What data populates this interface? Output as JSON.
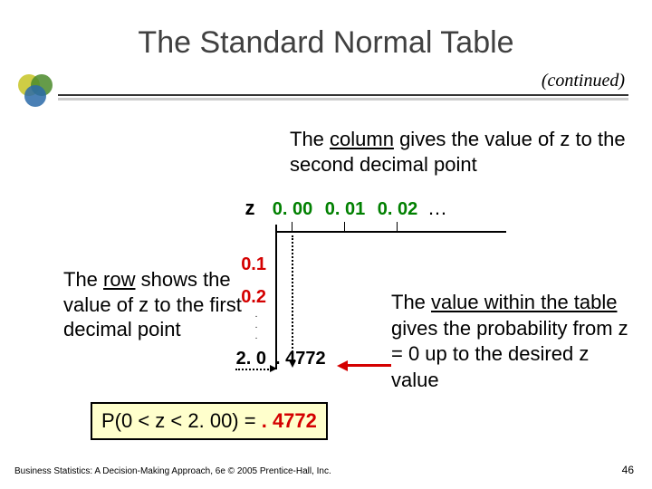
{
  "title": "The Standard Normal Table",
  "continued": "(continued)",
  "column_note": {
    "pre": "The ",
    "underlined": "column",
    "post": " gives the value of z to the second decimal point"
  },
  "row_note": {
    "pre": "The ",
    "underlined": "row",
    "post": " shows the value of z to the first decimal point"
  },
  "value_note": {
    "pre": "The ",
    "underlined": "value within the table",
    "post": " gives the probability from z = 0 up to the desired z value"
  },
  "table": {
    "z_label": "z",
    "col_headers": [
      "0. 00",
      "0. 01",
      "0. 02"
    ],
    "col_dots": "…",
    "row_headers": [
      "0.1",
      "0.2"
    ],
    "row_final": "2. 0",
    "cell_value": ". 4772"
  },
  "equation": {
    "lhs": "P(0 < z < 2. 00) = ",
    "rhs": ". 4772"
  },
  "footer": "Business Statistics: A Decision-Making Approach, 6e © 2005 Prentice-Hall, Inc.",
  "page_number": "46",
  "logo_colors": {
    "c1": "#c7c425",
    "c2": "#4a8a2a",
    "c3": "#2a6aa8"
  }
}
